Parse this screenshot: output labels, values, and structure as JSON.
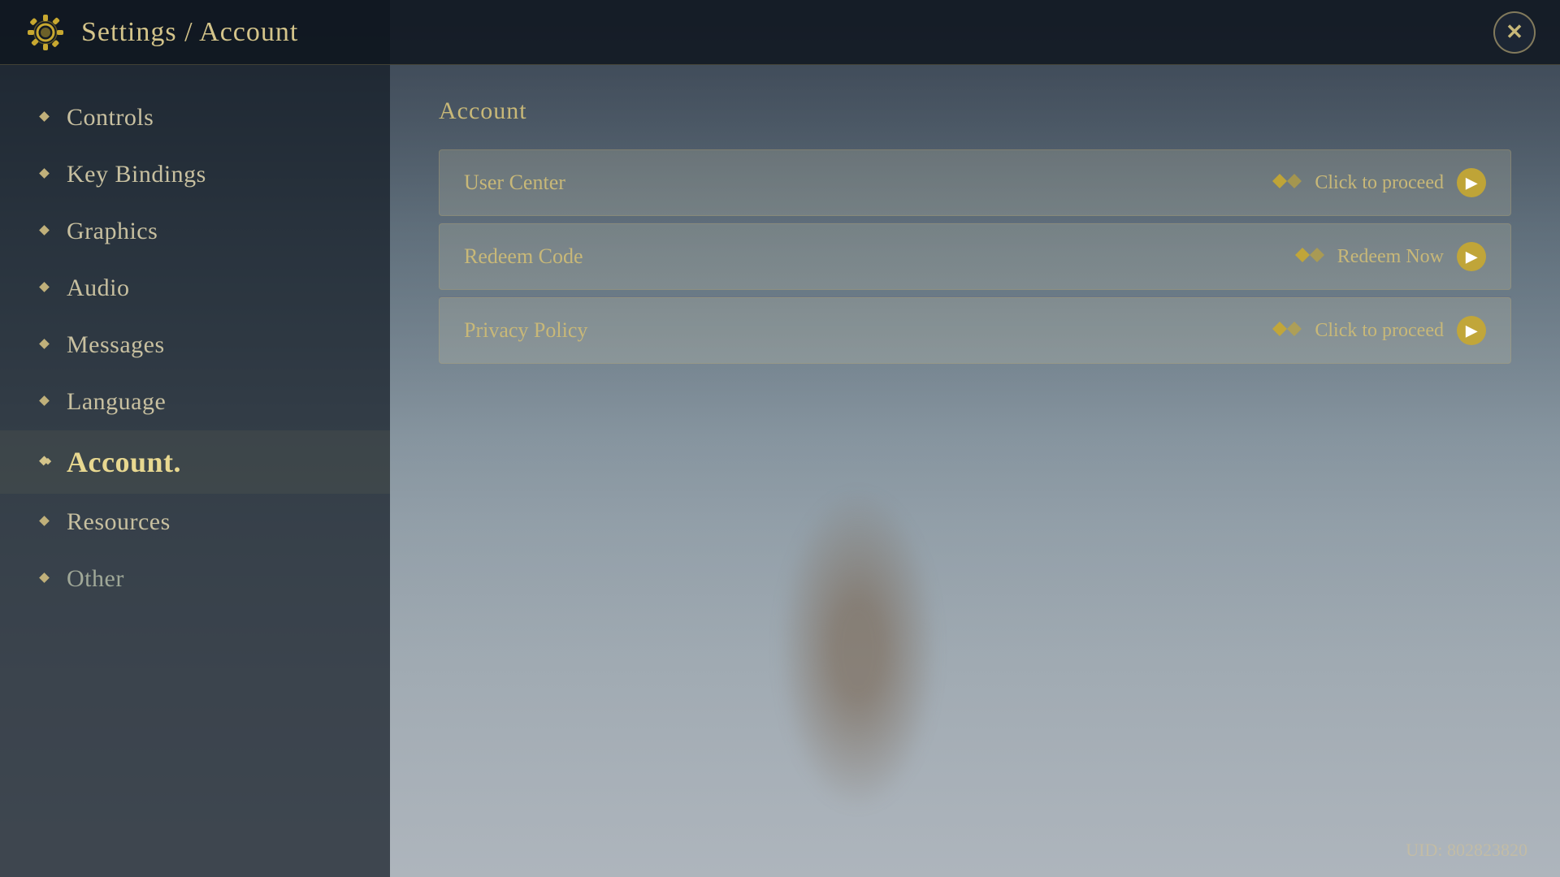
{
  "header": {
    "title": "Settings / Account",
    "icon": "gear-icon",
    "close_label": "✕"
  },
  "sidebar": {
    "items": [
      {
        "id": "controls",
        "label": "Controls",
        "active": false,
        "muted": false
      },
      {
        "id": "key-bindings",
        "label": "Key Bindings",
        "active": false,
        "muted": false
      },
      {
        "id": "graphics",
        "label": "Graphics",
        "active": false,
        "muted": false
      },
      {
        "id": "audio",
        "label": "Audio",
        "active": false,
        "muted": false
      },
      {
        "id": "messages",
        "label": "Messages",
        "active": false,
        "muted": false
      },
      {
        "id": "language",
        "label": "Language",
        "active": false,
        "muted": false
      },
      {
        "id": "account",
        "label": "Account.",
        "active": true,
        "muted": false
      },
      {
        "id": "resources",
        "label": "Resources",
        "active": false,
        "muted": false
      },
      {
        "id": "other",
        "label": "Other",
        "active": false,
        "muted": true
      }
    ]
  },
  "main": {
    "section_title": "Account",
    "rows": [
      {
        "id": "user-center",
        "label": "User Center",
        "action_text": "Click to proceed"
      },
      {
        "id": "redeem-code",
        "label": "Redeem Code",
        "action_text": "Redeem Now"
      },
      {
        "id": "privacy-policy",
        "label": "Privacy Policy",
        "action_text": "Click to proceed"
      }
    ]
  },
  "uid": {
    "label": "UID: 802823820"
  }
}
